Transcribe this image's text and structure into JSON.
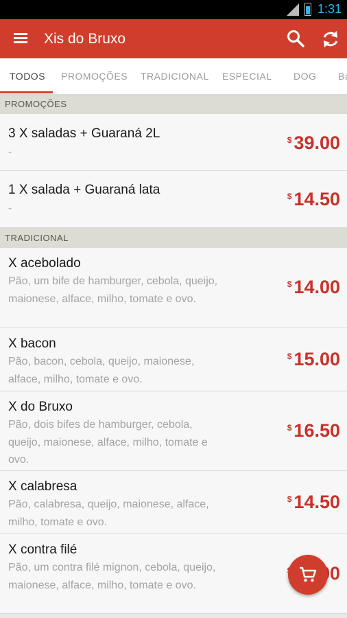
{
  "status_bar": {
    "network": "3G",
    "time": "1:31"
  },
  "toolbar": {
    "title": "Xis do Bruxo",
    "icons": [
      "menu-icon",
      "search-icon",
      "refresh-icon"
    ]
  },
  "tabs": [
    {
      "label": "TODOS",
      "active": true
    },
    {
      "label": "PROMOÇÕES"
    },
    {
      "label": "TRADICIONAL"
    },
    {
      "label": "ESPECIAL"
    },
    {
      "label": "DOG"
    },
    {
      "label": "Ba"
    }
  ],
  "sections": [
    {
      "title": "PROMOÇÕES",
      "items": [
        {
          "name": "3 X saladas + Guaraná 2L",
          "desc": "-",
          "currency": "$",
          "price": "39.00"
        },
        {
          "name": "1 X salada + Guaraná lata",
          "desc": "-",
          "currency": "$",
          "price": "14.50"
        }
      ]
    },
    {
      "title": "TRADICIONAL",
      "items": [
        {
          "name": "X acebolado",
          "desc": "Pão, um bife de hamburger, cebola, queijo, maionese, alface, milho, tomate e ovo.",
          "currency": "$",
          "price": "14.00"
        },
        {
          "name": "X bacon",
          "desc": "Pão, bacon, cebola, queijo, maionese, alface, milho, tomate e ovo.",
          "currency": "$",
          "price": "15.00"
        },
        {
          "name": "X do Bruxo",
          "desc": "Pão, dois bifes de hamburger, cebola, queijo, maionese, alface, milho, tomate e ovo.",
          "currency": "$",
          "price": "16.50"
        },
        {
          "name": "X calabresa",
          "desc": "Pão, calabresa, queijo, maionese, alface, milho, tomate e ovo.",
          "currency": "$",
          "price": "14.50"
        },
        {
          "name": "X contra filé",
          "desc": "Pão, um contra filé mignon, cebola, queijo, maionese, alface, milho, tomate e ovo.",
          "currency": "$",
          "price": "17.00"
        }
      ]
    }
  ],
  "fab": {
    "icon": "cart-icon"
  },
  "colors": {
    "primary": "#d13d2c",
    "price": "#c9312a",
    "section_bg": "#dcdcd2"
  }
}
